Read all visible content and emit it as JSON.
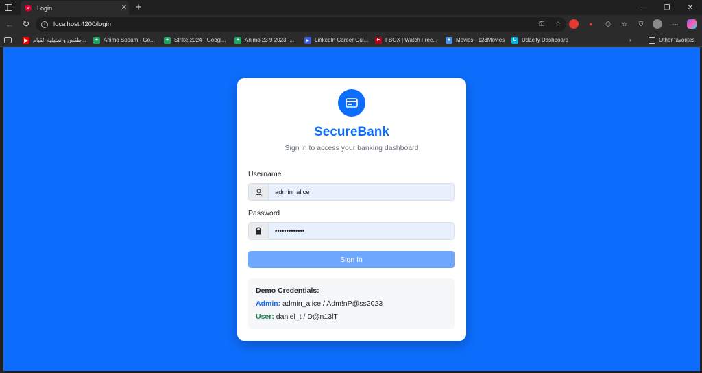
{
  "browser": {
    "tab_title": "Login",
    "url": "localhost:4200/login",
    "bookmarks": [
      {
        "label": "طقس و تمثيلية القيام...",
        "icon": "youtube-icon",
        "color": "#ff0000"
      },
      {
        "label": "Animo Sodam - Go...",
        "icon": "sheets-icon",
        "color": "#1fa463"
      },
      {
        "label": "Strike 2024 - Googl...",
        "icon": "sheets-icon",
        "color": "#1fa463"
      },
      {
        "label": "Animo 23 9 2023 -...",
        "icon": "sheets-icon",
        "color": "#1fa463"
      },
      {
        "label": "LinkedIn Career Gui...",
        "icon": "video-icon",
        "color": "#3b5bdb"
      },
      {
        "label": "FBOX | Watch Free...",
        "icon": "fbox-icon",
        "color": "#b3001b"
      },
      {
        "label": "Movies - 123Movies",
        "icon": "movies-icon",
        "color": "#4a90e2"
      },
      {
        "label": "Udacity Dashboard",
        "icon": "udacity-icon",
        "color": "#02b3e4"
      }
    ],
    "other_favorites": "Other favorites"
  },
  "login": {
    "brand": "SecureBank",
    "subtitle": "Sign in to access your banking dashboard",
    "username_label": "Username",
    "username_value": "admin_alice",
    "password_label": "Password",
    "password_value": "•••••••••••••",
    "signin_label": "Sign In",
    "demo": {
      "heading": "Demo Credentials:",
      "admin_label": "Admin:",
      "admin_creds": "admin_alice / Adm!nP@ss2023",
      "user_label": "User:",
      "user_creds": "daniel_t / D@n13lT"
    }
  },
  "colors": {
    "primary": "#0d6efd",
    "button_disabled": "#6ea8fe",
    "success": "#198754"
  }
}
